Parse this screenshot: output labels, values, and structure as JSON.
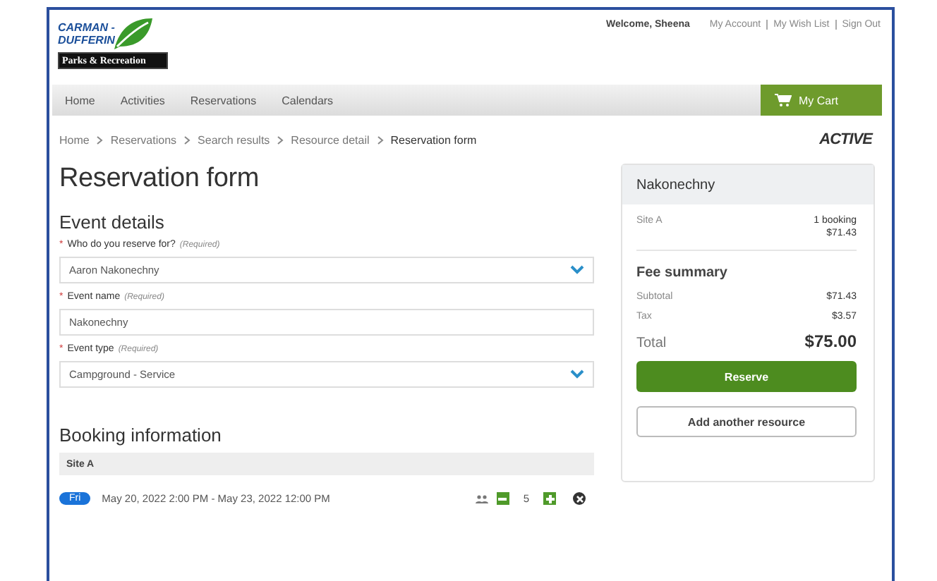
{
  "logo": {
    "lines": [
      "CARMAN -",
      "DUFFERIN"
    ],
    "tagline": "Parks & Recreation"
  },
  "user_bar": {
    "welcome": "Welcome, Sheena",
    "links": [
      "My Account",
      "My Wish List",
      "Sign Out"
    ]
  },
  "nav": {
    "items": [
      "Home",
      "Activities",
      "Reservations",
      "Calendars"
    ],
    "cart": "My Cart"
  },
  "breadcrumb": [
    "Home",
    "Reservations",
    "Search results",
    "Resource detail",
    "Reservation form"
  ],
  "brand": "ACTIVE",
  "title": "Reservation form",
  "event_details": {
    "heading": "Event details",
    "fields": [
      {
        "kind": "select",
        "required_mark": "*",
        "label": "Who do you reserve for?",
        "hint": "(Required)",
        "value": "Aaron Nakonechny"
      },
      {
        "kind": "text",
        "required_mark": "*",
        "label": "Event name",
        "hint": "(Required)",
        "value": "Nakonechny"
      },
      {
        "kind": "select",
        "required_mark": "*",
        "label": "Event type",
        "hint": "(Required)",
        "value": "Campground - Service"
      }
    ]
  },
  "booking": {
    "heading": "Booking information",
    "site": "Site A",
    "rows": [
      {
        "day": "Fri",
        "dates": "May 20, 2022 2:00 PM - May 23, 2022 12:00 PM",
        "count": "5"
      }
    ]
  },
  "summary": {
    "title": "Nakonechny",
    "item": "Site A",
    "bookings": "1 booking",
    "item_price": "$71.43",
    "fee_heading": "Fee summary",
    "lines": [
      {
        "label": "Subtotal",
        "value": "$71.43"
      },
      {
        "label": "Tax",
        "value": "$3.57"
      }
    ],
    "total_label": "Total",
    "total": "$75.00",
    "reserve": "Reserve",
    "add": "Add another resource"
  }
}
